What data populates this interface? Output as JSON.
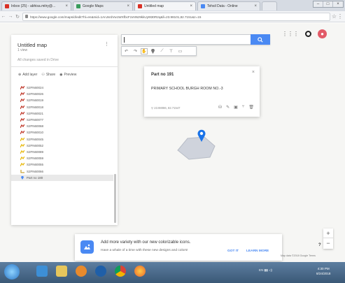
{
  "browser": {
    "tabs": [
      {
        "label": "Inbox (25) - abhisa.mitry@...",
        "color": "#d93025"
      },
      {
        "label": "Google Maps",
        "color": "#3a9c5c"
      },
      {
        "label": "Untitled map",
        "color": "#d93025"
      },
      {
        "label": "Tehsil Data - Online",
        "color": "#4a89f3"
      }
    ],
    "url": "https://www.google.com/maps/d/edit?hl=en&mid=1AnJsrdVw1WXfbcFzxNNz9kkUy9t30R2q&ll=23.98101,82.7151&z=15"
  },
  "map_ui": {
    "search_placeholder": "",
    "search_button_icon": "search-icon",
    "tools": [
      "undo-icon",
      "redo-icon",
      "hand-icon",
      "marker-icon",
      "line-icon",
      "filter-icon",
      "ruler-icon"
    ]
  },
  "panel": {
    "title": "Untitled map",
    "subtitle": "1 view",
    "description": "All changes saved in Drive",
    "actions": {
      "add_layer": "Add layer",
      "share": "Share",
      "preview": "Preview"
    },
    "items": [
      {
        "label": "S2FN60024",
        "color": "#c0392b"
      },
      {
        "label": "S2FN60026",
        "color": "#c0392b"
      },
      {
        "label": "S2FN60019",
        "color": "#c0392b"
      },
      {
        "label": "S2FN60018",
        "color": "#c0392b"
      },
      {
        "label": "S2FN60021",
        "color": "#c0392b"
      },
      {
        "label": "S2FN60077",
        "color": "#c0392b"
      },
      {
        "label": "S2FN60068",
        "color": "#c0392b"
      },
      {
        "label": "S2FN60010",
        "color": "#c0392b"
      },
      {
        "label": "S2FN60045",
        "color": "#e8b90e"
      },
      {
        "label": "S2FN60052",
        "color": "#e8b90e"
      },
      {
        "label": "S2FN60089",
        "color": "#e8b90e"
      },
      {
        "label": "S2FN60059",
        "color": "#e8b90e"
      },
      {
        "label": "S2FN60055",
        "color": "#e8b90e"
      },
      {
        "label": "S2FN60066",
        "color": "#c9a43a"
      },
      {
        "label": "Part no 180",
        "color": "#4a89f3"
      }
    ]
  },
  "card": {
    "title": "Part no 191",
    "description": "PRIMARY SCHOOL BURGH ROOM NO.-3",
    "coords": "23.98086, 82.71547"
  },
  "banner": {
    "title": "Add more variety with our new colorizable icons.",
    "subtitle": "Have a whale of a time with these new designs and colors!",
    "got_it": "GOT IT",
    "learn_more": "LEARN MORE"
  },
  "map_footer": {
    "zoom_in": "+",
    "zoom_out": "−",
    "help": "?",
    "attribution": "Map data ©2018 Google  Terms"
  },
  "taskbar": {
    "tray": "EN",
    "time": "4:30 PM",
    "date": "8/24/2018"
  }
}
